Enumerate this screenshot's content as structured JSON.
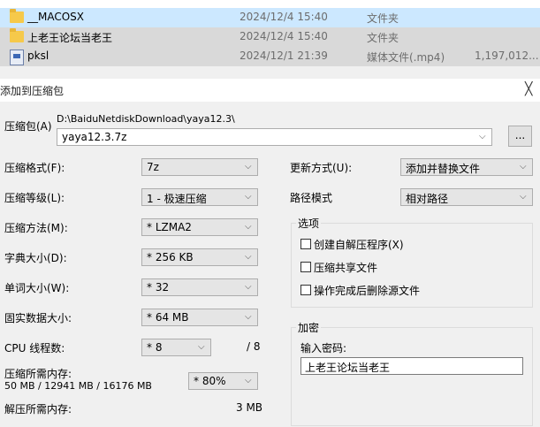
{
  "files": [
    {
      "name": "__MACOSX",
      "date": "2024/12/4 15:40",
      "type": "文件夹",
      "size": "",
      "icon": "folder-icon"
    },
    {
      "name": "上老王论坛当老王",
      "date": "2024/12/4 15:40",
      "type": "文件夹",
      "size": "",
      "icon": "folder-icon"
    },
    {
      "name": "pksl",
      "date": "2024/12/1 21:39",
      "type": "媒体文件(.mp4)",
      "size": "1,197,012...",
      "icon": "media-file-icon"
    }
  ],
  "dialog": {
    "title": "添加到压缩包",
    "archive_label": "压缩包(A)",
    "archive_path": "D:\\BaiduNetdiskDownload\\yaya12.3\\",
    "archive_name": "yaya12.3.7z",
    "browse_label": "...",
    "format_label": "压缩格式(F):",
    "format_value": "7z",
    "level_label": "压缩等级(L):",
    "level_value": "1 - 极速压缩",
    "method_label": "压缩方法(M):",
    "method_value": "* LZMA2",
    "dict_label": "字典大小(D):",
    "dict_value": "* 256 KB",
    "word_label": "单词大小(W):",
    "word_value": "* 32",
    "solid_label": "固实数据大小:",
    "solid_value": "* 64 MB",
    "cpu_label": "CPU 线程数:",
    "cpu_value": "* 8",
    "cpu_total": "/ 8",
    "mem_comp_label": "压缩所需内存:",
    "mem_comp_detail": "50 MB / 12941 MB / 16176 MB",
    "mem_comp_value": "* 80%",
    "mem_decomp_label": "解压所需内存:",
    "mem_decomp_value": "3 MB",
    "update_label": "更新方式(U):",
    "update_value": "添加并替换文件",
    "path_label": "路径模式",
    "path_value": "相对路径",
    "options_title": "选项",
    "opt_sfx": "创建自解压程序(X)",
    "opt_shared": "压缩共享文件",
    "opt_delete": "操作完成后删除源文件",
    "encrypt_title": "加密",
    "password_label": "输入密码:",
    "password_value": "上老王论坛当老王",
    "close_glyph": "╳"
  }
}
